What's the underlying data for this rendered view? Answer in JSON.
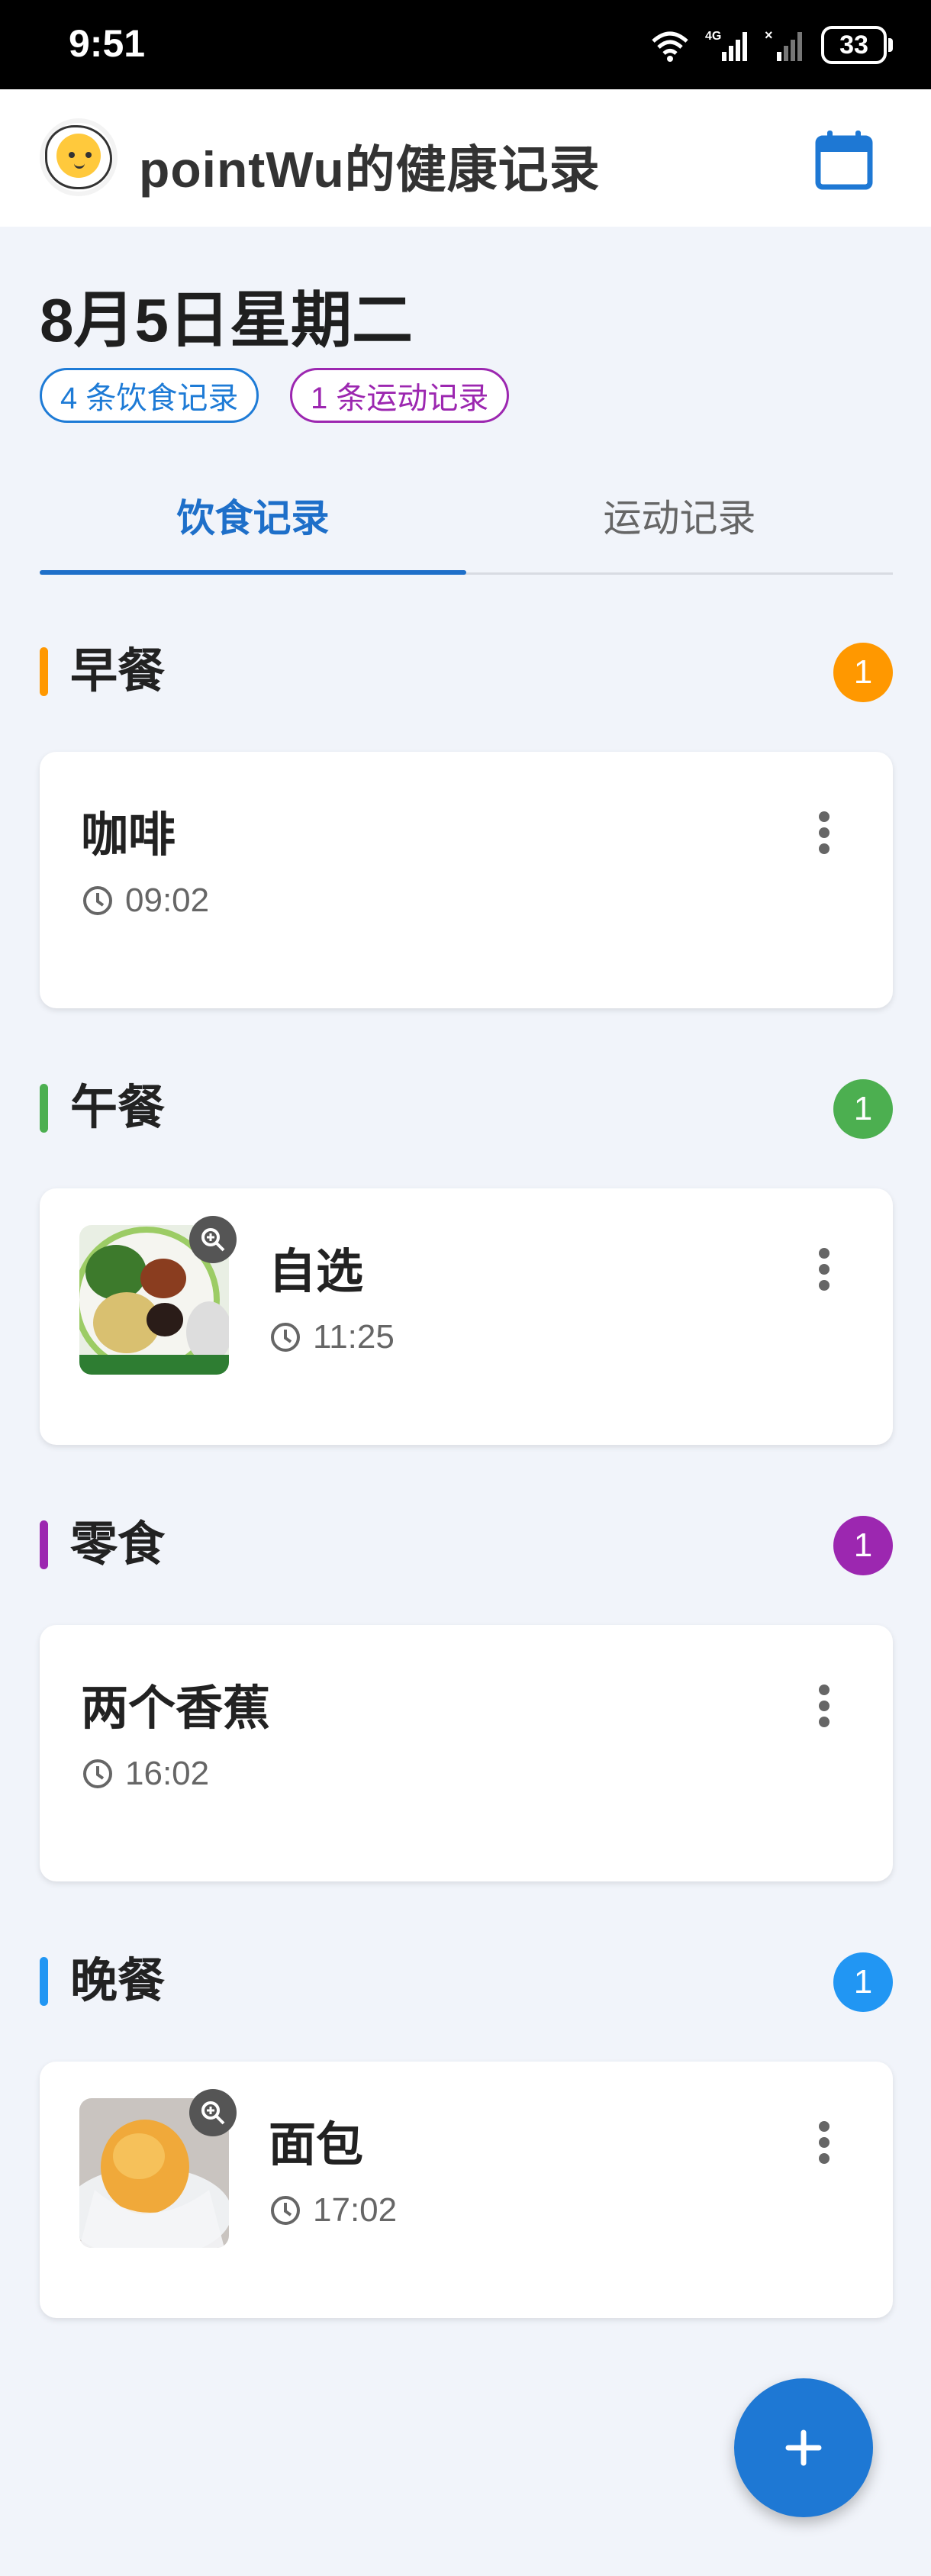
{
  "status_bar": {
    "time": "9:51",
    "battery": "33",
    "network": "4G"
  },
  "app_bar": {
    "title": "pointWu的健康记录",
    "calendar_icon": "calendar-icon",
    "avatar": "egg-avatar"
  },
  "date_header": {
    "date": "8月5日星期二",
    "food_chip": "4 条饮食记录",
    "exercise_chip": "1 条运动记录"
  },
  "tabs": [
    {
      "label": "饮食记录",
      "active": true
    },
    {
      "label": "运动记录",
      "active": false
    }
  ],
  "meals": [
    {
      "title": "早餐",
      "count": "1",
      "color": "#ff9800",
      "items": [
        {
          "name": "咖啡",
          "time": "09:02",
          "has_photo": false
        }
      ]
    },
    {
      "title": "午餐",
      "count": "1",
      "color": "#4caf50",
      "items": [
        {
          "name": "自选",
          "time": "11:25",
          "has_photo": true
        }
      ]
    },
    {
      "title": "零食",
      "count": "1",
      "color": "#9c27b0",
      "items": [
        {
          "name": "两个香蕉",
          "time": "16:02",
          "has_photo": false
        }
      ]
    },
    {
      "title": "晚餐",
      "count": "1",
      "color": "#2196f3",
      "items": [
        {
          "name": "面包",
          "time": "17:02",
          "has_photo": true
        }
      ]
    }
  ],
  "fab": {
    "icon": "plus-icon"
  }
}
